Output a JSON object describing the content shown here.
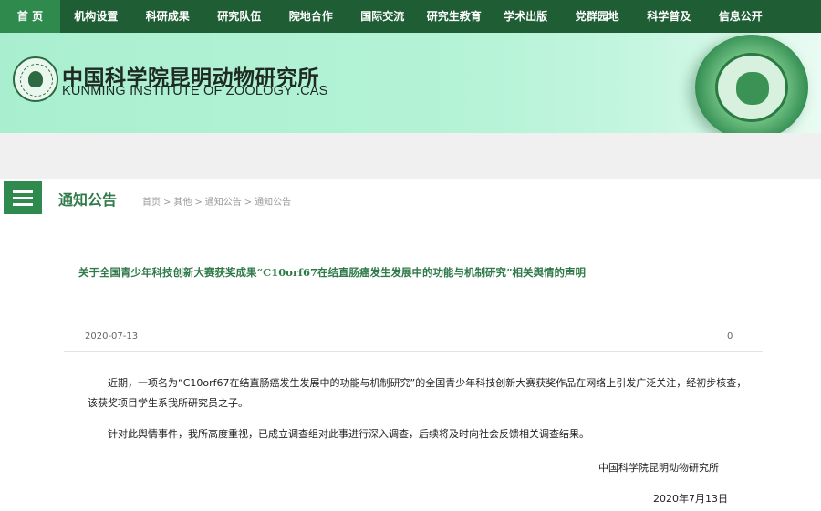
{
  "nav": {
    "items": [
      {
        "label": "首 页",
        "active": true
      },
      {
        "label": "机构设置"
      },
      {
        "label": "科研成果"
      },
      {
        "label": "研究队伍"
      },
      {
        "label": "院地合作"
      },
      {
        "label": "国际交流"
      },
      {
        "label": "研究生教育"
      },
      {
        "label": "学术出版"
      },
      {
        "label": "党群园地"
      },
      {
        "label": "科学普及"
      },
      {
        "label": "信息公开"
      }
    ]
  },
  "header": {
    "name_cn": "中国科学院昆明动物研究所",
    "name_en": "KUNMING INSTITUTE OF ZOOLOGY .CAS",
    "logo_icon": "institute-logo",
    "emblem_icon": "institute-emblem"
  },
  "section": {
    "menu_icon": "hamburger-menu-icon",
    "title": "通知公告",
    "breadcrumb": [
      "首页",
      "其他",
      "通知公告",
      "通知公告"
    ],
    "breadcrumb_sep": ">"
  },
  "article": {
    "title": "关于全国青少年科技创新大赛获奖成果“C10orf67在结直肠癌发生发展中的功能与机制研究”相关舆情的声明",
    "date": "2020-07-13",
    "views": "0",
    "paragraphs": [
      "近期，一项名为“C10orf67在结直肠癌发生发展中的功能与机制研究”的全国青少年科技创新大赛获奖作品在网络上引发广泛关注，经初步核查，该获奖项目学生系我所研究员之子。",
      "针对此舆情事件，我所高度重视，已成立调查组对此事进行深入调查，后续将及时向社会反馈相关调查结果。"
    ],
    "signature": "中国科学院昆明动物研究所",
    "sign_date": "2020年7月13日"
  },
  "colors": {
    "nav_bg": "#1f5d35",
    "nav_active": "#2f8a4e",
    "banner": "#a9efcf",
    "accent_green": "#2f7a48"
  }
}
